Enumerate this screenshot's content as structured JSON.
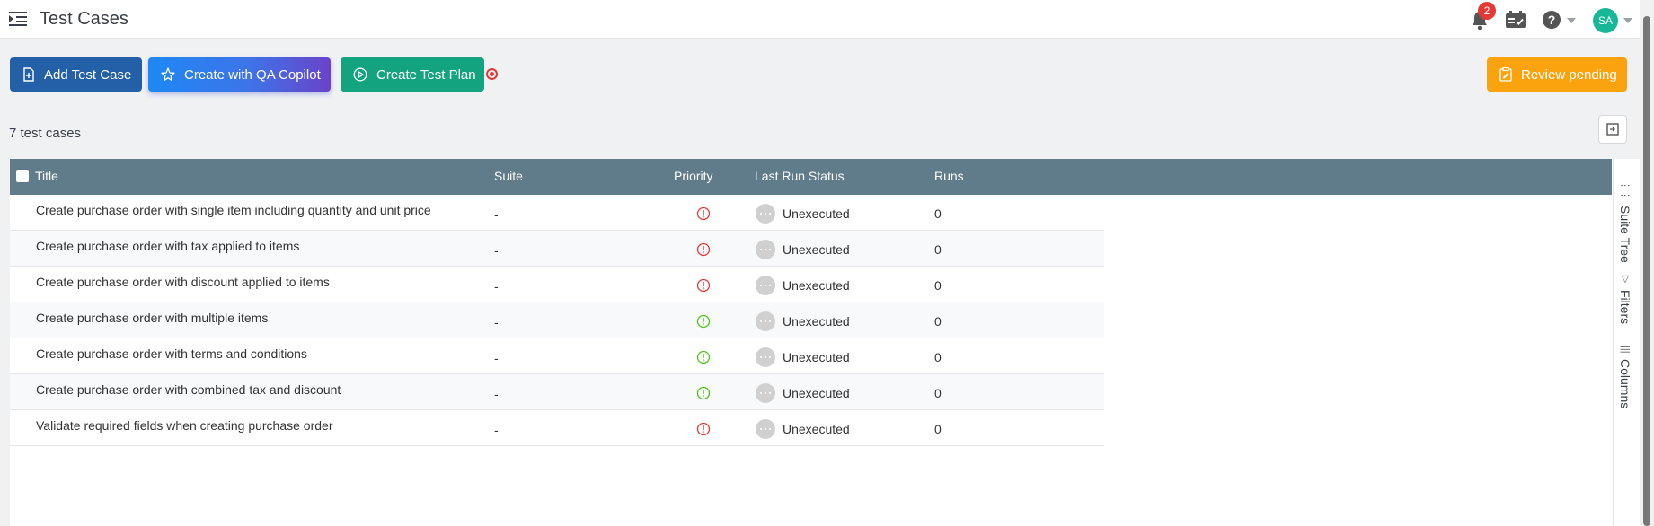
{
  "header": {
    "title": "Test Cases",
    "notification_count": "2",
    "avatar_initials": "SA"
  },
  "toolbar": {
    "add_label": "Add Test Case",
    "copilot_label": "Create with QA Copilot",
    "plan_label": "Create Test Plan",
    "review_label": "Review pending"
  },
  "summary": {
    "count_text": "7 test cases"
  },
  "table": {
    "columns": {
      "title": "Title",
      "suite": "Suite",
      "priority": "Priority",
      "status": "Last Run Status",
      "runs": "Runs"
    },
    "rows": [
      {
        "title": "Create purchase order with single item including quantity and unit price",
        "suite": "-",
        "priority": "high",
        "status": "Unexecuted",
        "runs": "0"
      },
      {
        "title": "Create purchase order with tax applied to items",
        "suite": "-",
        "priority": "high",
        "status": "Unexecuted",
        "runs": "0"
      },
      {
        "title": "Create purchase order with discount applied to items",
        "suite": "-",
        "priority": "high",
        "status": "Unexecuted",
        "runs": "0"
      },
      {
        "title": "Create purchase order with multiple items",
        "suite": "-",
        "priority": "low",
        "status": "Unexecuted",
        "runs": "0"
      },
      {
        "title": "Create purchase order with terms and conditions",
        "suite": "-",
        "priority": "low",
        "status": "Unexecuted",
        "runs": "0"
      },
      {
        "title": "Create purchase order with combined tax and discount",
        "suite": "-",
        "priority": "low",
        "status": "Unexecuted",
        "runs": "0"
      },
      {
        "title": "Validate required fields when creating purchase order",
        "suite": "-",
        "priority": "high",
        "status": "Unexecuted",
        "runs": "0"
      }
    ]
  },
  "side_panel": {
    "suite_tree": "Suite Tree",
    "filters": "Filters",
    "columns": "Columns"
  },
  "colors": {
    "priority_high": "#e53935",
    "priority_low": "#52c41a"
  }
}
